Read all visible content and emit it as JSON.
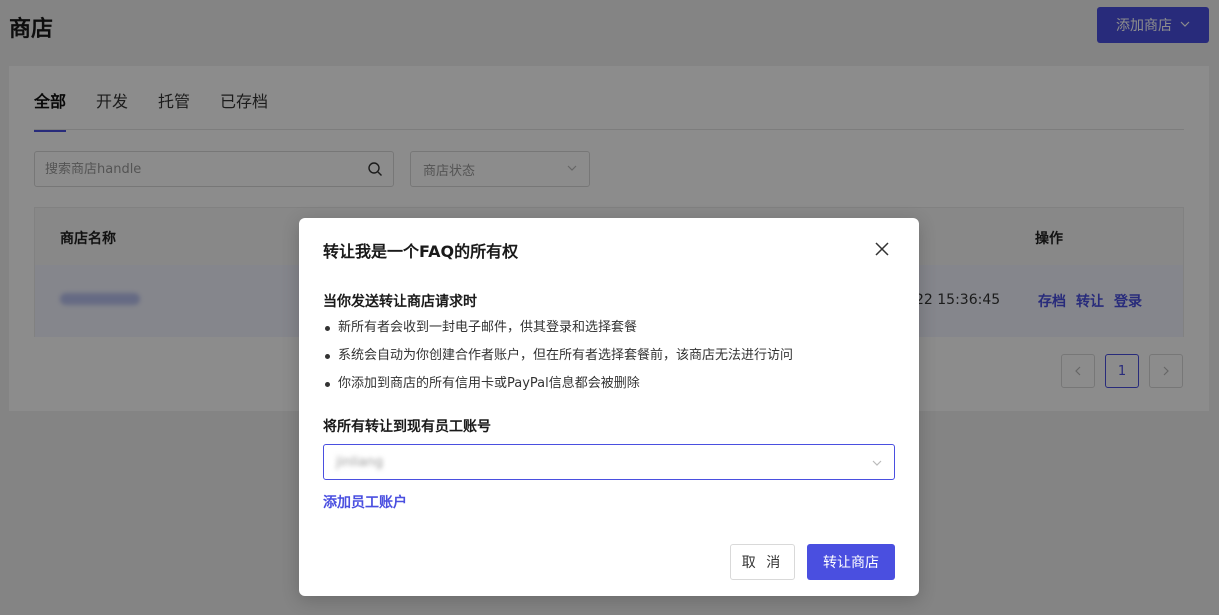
{
  "header": {
    "title": "商店",
    "add_store_label": "添加商店"
  },
  "tabs": [
    {
      "label": "全部",
      "active": true
    },
    {
      "label": "开发",
      "active": false
    },
    {
      "label": "托管",
      "active": false
    },
    {
      "label": "已存档",
      "active": false
    }
  ],
  "filters": {
    "search_placeholder": "搜索商店handle",
    "status_placeholder": "商店状态"
  },
  "table": {
    "columns": {
      "name": "商店名称",
      "actions": "操作"
    },
    "rows": [
      {
        "date": "22 15:36:45",
        "actions": [
          "存档",
          "转让",
          "登录"
        ]
      }
    ]
  },
  "pagination": {
    "prev": "<",
    "current": "1",
    "next": ">"
  },
  "modal": {
    "title": "转让我是一个FAQ的所有权",
    "request_heading": "当你发送转让商店请求时",
    "bullets": [
      "新所有者会收到一封电子邮件，供其登录和选择套餐",
      "系统会自动为你创建合作者账户，但在所有者选择套餐前，该商店无法进行访问",
      "你添加到商店的所有信用卡或PayPal信息都会被删除"
    ],
    "staff_heading": "将所有转让到现有员工账号",
    "staff_value": "jinliang",
    "add_staff_link": "添加员工账户",
    "cancel_label": "取 消",
    "transfer_label": "转让商店"
  },
  "colors": {
    "accent": "#4a4fe0"
  }
}
